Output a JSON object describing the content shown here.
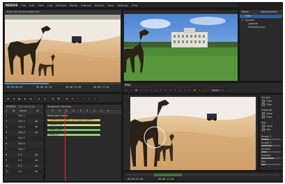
{
  "app": {
    "name": "REDIUS"
  },
  "menu": [
    "File",
    "Edit",
    "View",
    "Clip",
    "Window",
    "Media",
    "Capture",
    "Render",
    "Tools",
    "Settings",
    "Help"
  ],
  "source_viewer": {
    "title": "Amin Kin Fischmenden Pro"
  },
  "source_timecodes": [
    "00:00:00:01",
    "00:00:16:15",
    "00:00:25:00",
    "00:00:17:20"
  ],
  "project_panel": {
    "title": "REDIUS",
    "tab": "Ext Vorschau",
    "columns": [
      "V",
      "Nr",
      "Name",
      "Inf"
    ],
    "rows": [
      {
        "v": "1",
        "name": "Clip 1",
        "inf": ""
      },
      {
        "v": "2",
        "name": "Clip 2",
        "inf": "ab"
      },
      {
        "v": "3",
        "name": "Clip 3",
        "inf": "ab"
      },
      {
        "v": "4",
        "name": "Clip 4",
        "inf": "ab"
      },
      {
        "v": "5",
        "name": "Clip 5",
        "inf": ""
      },
      {
        "v": "6",
        "name": "Clip 6",
        "inf": ""
      },
      {
        "v": "7",
        "name": "Clip 7",
        "inf": ""
      },
      {
        "v": "8",
        "name": "A 1",
        "inf": "ab"
      },
      {
        "v": "9",
        "name": "A 2",
        "inf": "ab"
      },
      {
        "v": "10",
        "name": "A 3",
        "inf": "ab"
      },
      {
        "v": "11",
        "name": "A 4",
        "inf": "ab"
      }
    ]
  },
  "sequence_panel": {
    "tab": "Sequence Timeline",
    "header": "Bildinhalt Ordnen",
    "clips": [
      {
        "label": "FILMPB FILM CAMEL CLIP AUDIO SAMPLE",
        "color": "#e9c36b"
      },
      {
        "label": "FILMPB_CLIP",
        "color": "#c8d98a"
      },
      {
        "label": "CAMEL_AUD",
        "color": "#7fc06a"
      },
      {
        "label": "SAND_02",
        "color": "#8fcf6e"
      }
    ]
  },
  "explorer": {
    "header": [
      "Name",
      "Eigenschaften"
    ],
    "items": [
      "Filter",
      "Symbol",
      "Laborbe",
      "Glanztexrsche"
    ]
  },
  "effects_panel": {
    "title": "Efek",
    "zoom": "100%",
    "sections": [
      {
        "label": "Ozurgiv",
        "items": [
          "Flipx",
          "Flipy"
        ]
      },
      {
        "label": "Ortsmolk",
        "items": [
          "Deep",
          "Flipx"
        ]
      },
      {
        "label": "Sigu",
        "items": [
          "Lacor",
          "Sob"
        ]
      }
    ],
    "params": [
      "Amper 1",
      "Amper 2",
      "Vertikal",
      "Scheibe",
      "Zen"
    ]
  },
  "bottom_bar": [
    "00:00:25:00",
    "00:00:17:20"
  ],
  "colors": {
    "accent": "#2f5f9e",
    "panel": "#2a2a2a",
    "desert": "#d9b483",
    "sky": "#5a8fd6"
  }
}
